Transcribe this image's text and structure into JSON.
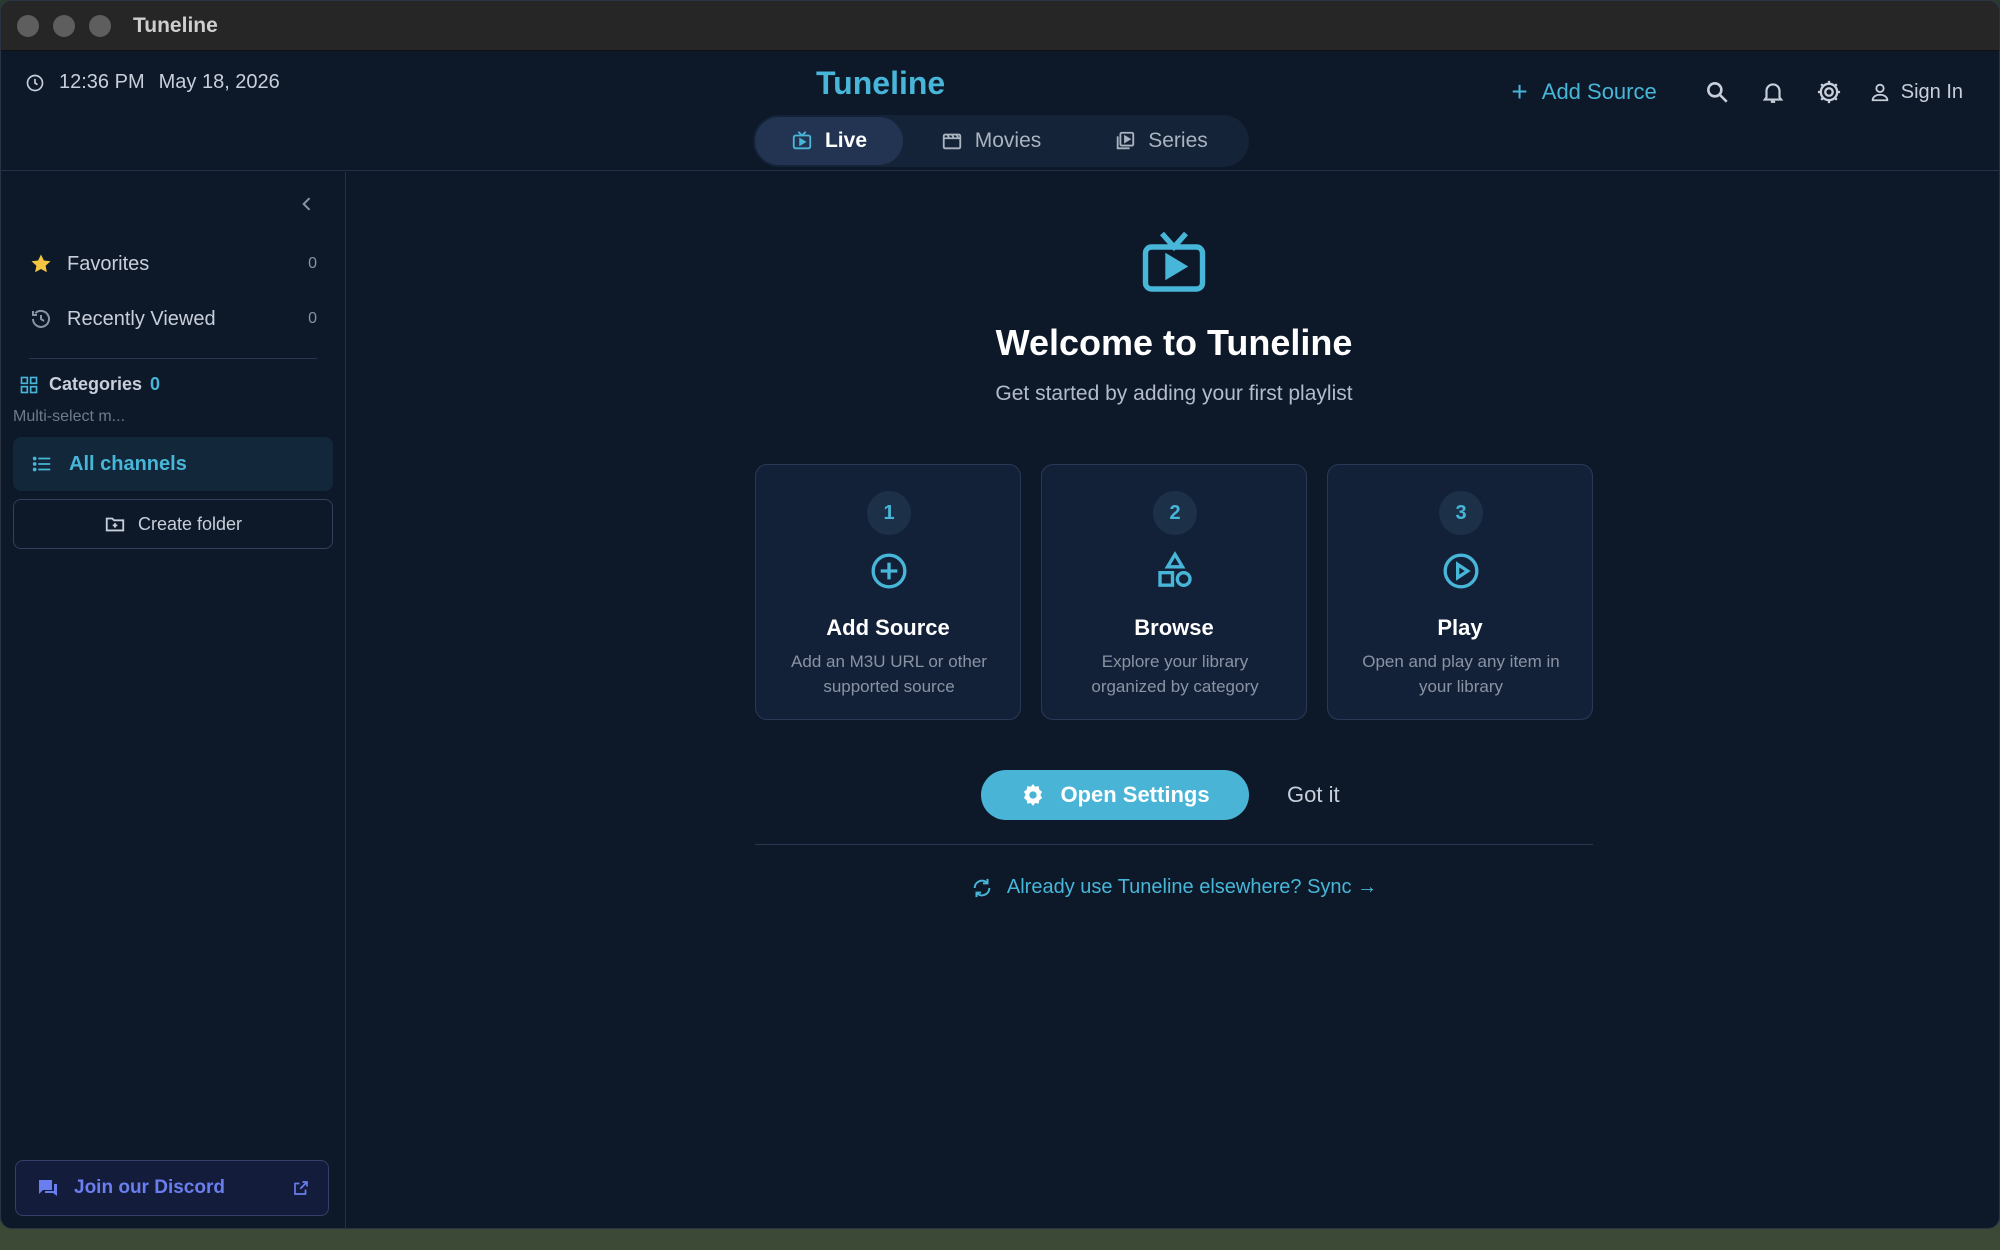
{
  "window": {
    "title": "Tuneline"
  },
  "header": {
    "time": "12:36 PM",
    "date": "May 18, 2026",
    "brand": "Tuneline",
    "add_source_label": "Add Source",
    "sign_in_label": "Sign In",
    "icons": [
      "search-icon",
      "bell-icon",
      "gear-icon",
      "user-icon"
    ]
  },
  "tabs": [
    {
      "label": "Live",
      "active": true
    },
    {
      "label": "Movies",
      "active": false
    },
    {
      "label": "Series",
      "active": false
    }
  ],
  "sidebar": {
    "favorites": {
      "label": "Favorites",
      "count": "0"
    },
    "recent": {
      "label": "Recently Viewed",
      "count": "0"
    },
    "categories": {
      "label": "Categories",
      "count": "0",
      "hint": "Multi-select m..."
    },
    "all_channels": "All channels",
    "create_folder": "Create folder",
    "discord": "Join our Discord"
  },
  "main": {
    "title": "Welcome to Tuneline",
    "subtitle": "Get started by adding your first playlist",
    "steps": [
      {
        "num": "1",
        "title": "Add Source",
        "desc": "Add an M3U URL or other supported source"
      },
      {
        "num": "2",
        "title": "Browse",
        "desc": "Explore your library organized by category"
      },
      {
        "num": "3",
        "title": "Play",
        "desc": "Open and play any item in your library"
      }
    ],
    "open_settings": "Open Settings",
    "got_it": "Got it",
    "sync": "Already use Tuneline elsewhere? Sync →"
  },
  "colors": {
    "accent": "#48b6d8",
    "background": "#0d1828",
    "card": "#132138",
    "discord": "#6a7ef0",
    "star": "#f5c542"
  }
}
